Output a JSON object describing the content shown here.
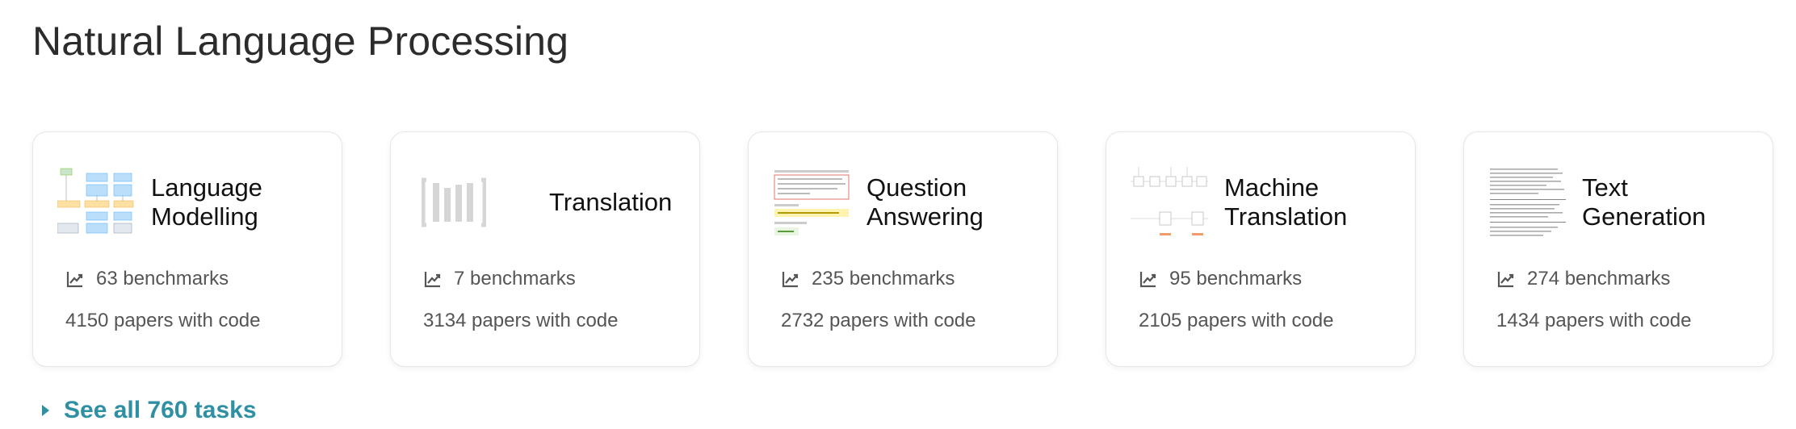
{
  "section": {
    "title": "Natural Language Processing"
  },
  "cards": [
    {
      "title": "Language Modelling",
      "benchmarks": "63 benchmarks",
      "papers": "4150 papers with code",
      "thumbnail": "language-modelling-diagram"
    },
    {
      "title": "Translation",
      "benchmarks": "7 benchmarks",
      "papers": "3134 papers with code",
      "thumbnail": "placeholder-bars"
    },
    {
      "title": "Question Answering",
      "benchmarks": "235 benchmarks",
      "papers": "2732 papers with code",
      "thumbnail": "qa-passage-sample"
    },
    {
      "title": "Machine Translation",
      "benchmarks": "95 benchmarks",
      "papers": "2105 papers with code",
      "thumbnail": "seq2seq-diagram"
    },
    {
      "title": "Text Generation",
      "benchmarks": "274 benchmarks",
      "papers": "1434 papers with code",
      "thumbnail": "text-sample"
    }
  ],
  "see_all": {
    "label": "See all 760 tasks",
    "icon": "caret-right-icon"
  },
  "colors": {
    "link": "#2f8fa3",
    "card_border": "#e6e6e6"
  }
}
